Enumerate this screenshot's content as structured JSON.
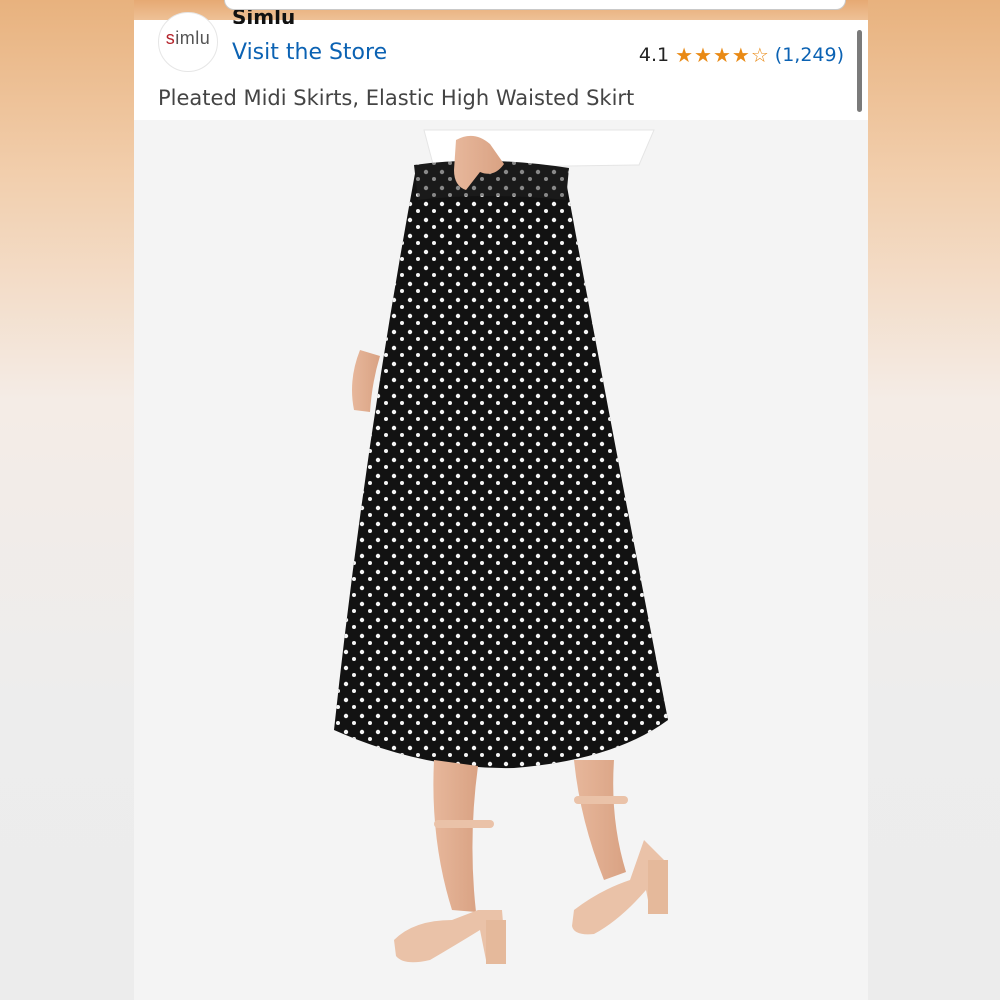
{
  "store": {
    "brand": "Simlu",
    "logo_text": "simlu",
    "visit_label": "Visit the Store"
  },
  "rating": {
    "value": "4.1",
    "stars": 4.1,
    "count": "(1,249)"
  },
  "product": {
    "title": "Pleated Midi Skirts, Elastic High Waisted Skirt",
    "image": "product-photo"
  },
  "colors": {
    "link": "#0b62b3",
    "star": "#e98a15",
    "header_orange": "#e6a973"
  }
}
